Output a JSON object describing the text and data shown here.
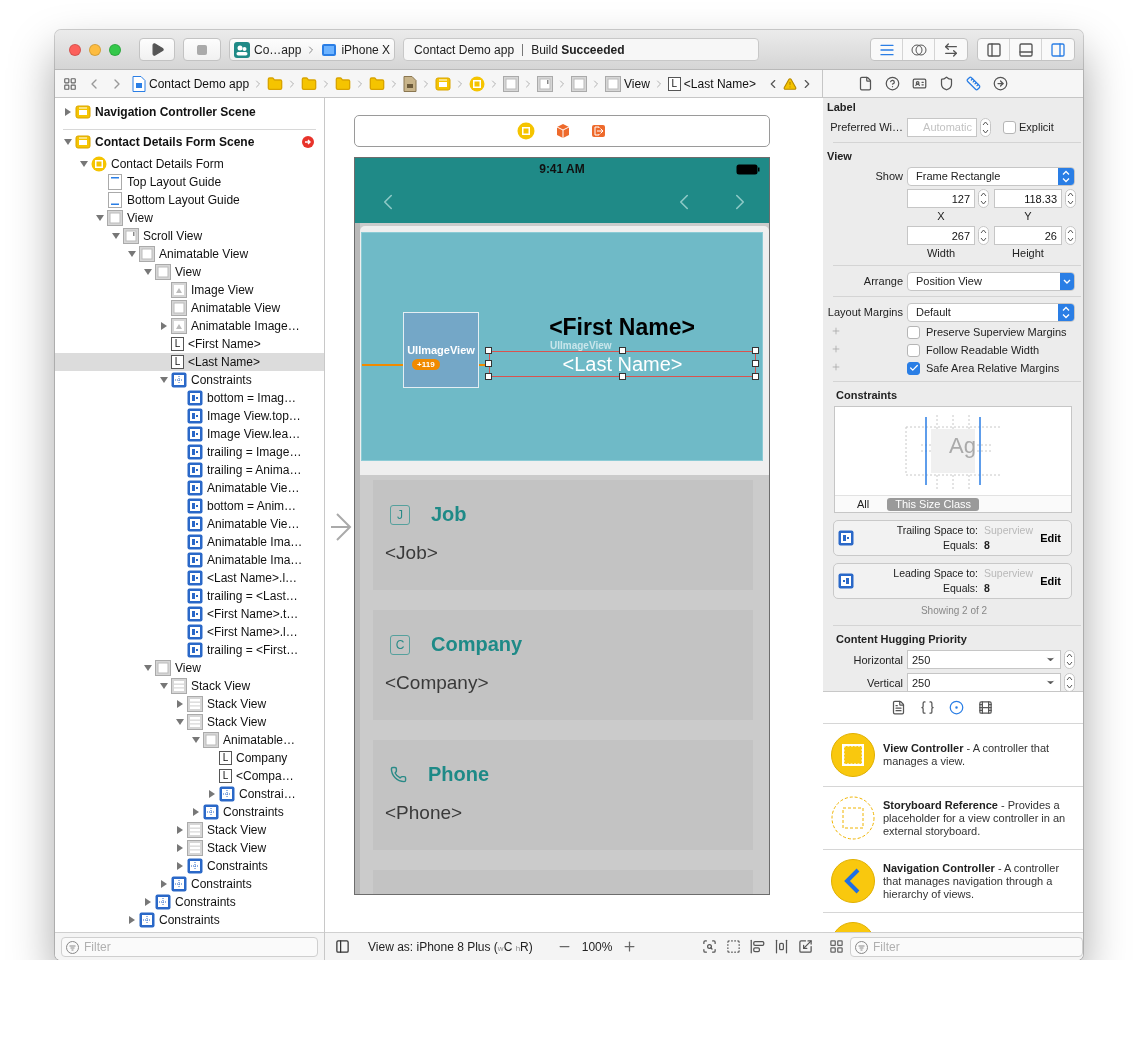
{
  "toolbar": {
    "scheme": "Co…app",
    "device": "iPhone X",
    "activity_project": "Contact Demo app",
    "activity_status": "Build **Succeeded**",
    "editor_modes": [
      {
        "kind": "standard",
        "selected": true
      },
      {
        "kind": "assistant",
        "selected": false
      },
      {
        "kind": "version",
        "selected": false
      }
    ],
    "panels": [
      {
        "kind": "navigator",
        "on": false
      },
      {
        "kind": "debug",
        "on": false
      },
      {
        "kind": "utilities",
        "on": true
      }
    ]
  },
  "jump_bar": {
    "items": [
      {
        "kind": "project",
        "label": "Contact Demo app"
      },
      {
        "kind": "folder"
      },
      {
        "kind": "folder"
      },
      {
        "kind": "folder"
      },
      {
        "kind": "folder"
      },
      {
        "kind": "storyboard"
      },
      {
        "kind": "scene"
      },
      {
        "kind": "controller"
      },
      {
        "kind": "view"
      },
      {
        "kind": "scroll"
      },
      {
        "kind": "view"
      },
      {
        "kind": "view",
        "label": "View"
      },
      {
        "kind": "label",
        "icon_text": "L",
        "label": "<Last Name>"
      }
    ]
  },
  "inspector_tabs": [
    {
      "kind": "file",
      "selected": false
    },
    {
      "kind": "help",
      "selected": false
    },
    {
      "kind": "identity",
      "selected": false
    },
    {
      "kind": "attributes",
      "selected": false
    },
    {
      "kind": "size",
      "selected": true
    },
    {
      "kind": "connections",
      "selected": false
    }
  ],
  "outline": {
    "filter_placeholder": "Filter",
    "items": [
      {
        "label": "Navigation Controller Scene",
        "kind": "scene",
        "expanded": false,
        "selected": false
      },
      {
        "label": "Contact Details Form Scene",
        "kind": "scene",
        "expanded": true,
        "selected": false,
        "error": true,
        "children": [
          {
            "label": "Contact Details Form",
            "kind": "controller",
            "expanded": true,
            "selected": false,
            "children": [
              {
                "label": "Top Layout Guide",
                "kind": "guide-top",
                "selected": false
              },
              {
                "label": "Bottom Layout Guide",
                "kind": "guide-bottom",
                "selected": false
              },
              {
                "label": "View",
                "kind": "view",
                "expanded": true,
                "selected": false,
                "children": [
                  {
                    "label": "Scroll View",
                    "kind": "scroll",
                    "expanded": true,
                    "selected": false,
                    "children": [
                      {
                        "label": "Animatable View",
                        "kind": "view",
                        "expanded": true,
                        "selected": false,
                        "children": [
                          {
                            "label": "View",
                            "kind": "view",
                            "expanded": true,
                            "selected": false,
                            "children": [
                              {
                                "label": "Image View",
                                "kind": "image",
                                "selected": false
                              },
                              {
                                "label": "Animatable View",
                                "kind": "view",
                                "selected": false
                              },
                              {
                                "label": "Animatable Image…",
                                "kind": "image",
                                "expanded": false,
                                "selected": false
                              },
                              {
                                "label": "<First Name>",
                                "kind": "label",
                                "icon_text": "L",
                                "selected": false
                              },
                              {
                                "label": "<Last Name>",
                                "kind": "label",
                                "icon_text": "L",
                                "selected": true
                              },
                              {
                                "label": "Constraints",
                                "kind": "constraints",
                                "expanded": true,
                                "selected": false,
                                "children": [
                                  {
                                    "label": "bottom = Imag…",
                                    "kind": "constraint",
                                    "selected": false
                                  },
                                  {
                                    "label": "Image View.top…",
                                    "kind": "constraint",
                                    "selected": false
                                  },
                                  {
                                    "label": "Image View.lea…",
                                    "kind": "constraint",
                                    "selected": false
                                  },
                                  {
                                    "label": "trailing = Image…",
                                    "kind": "constraint",
                                    "selected": false
                                  },
                                  {
                                    "label": "trailing = Anima…",
                                    "kind": "constraint",
                                    "selected": false
                                  },
                                  {
                                    "label": "Animatable Vie…",
                                    "kind": "constraint",
                                    "selected": false
                                  },
                                  {
                                    "label": "bottom = Anim…",
                                    "kind": "constraint",
                                    "selected": false
                                  },
                                  {
                                    "label": "Animatable Vie…",
                                    "kind": "constraint",
                                    "selected": false
                                  },
                                  {
                                    "label": "Animatable Ima…",
                                    "kind": "constraint",
                                    "selected": false
                                  },
                                  {
                                    "label": "Animatable Ima…",
                                    "kind": "constraint",
                                    "selected": false
                                  },
                                  {
                                    "label": "<Last Name>.l…",
                                    "kind": "constraint",
                                    "selected": false
                                  },
                                  {
                                    "label": "trailing = <Last…",
                                    "kind": "constraint",
                                    "selected": false
                                  },
                                  {
                                    "label": "<First Name>.t…",
                                    "kind": "constraint",
                                    "selected": false
                                  },
                                  {
                                    "label": "<First Name>.l…",
                                    "kind": "constraint",
                                    "selected": false
                                  },
                                  {
                                    "label": "trailing = <First…",
                                    "kind": "constraint",
                                    "selected": false
                                  }
                                ]
                              }
                            ]
                          },
                          {
                            "label": "View",
                            "kind": "view",
                            "expanded": true,
                            "selected": false,
                            "children": [
                              {
                                "label": "Stack View",
                                "kind": "stack",
                                "expanded": true,
                                "selected": false,
                                "children": [
                                  {
                                    "label": "Stack View",
                                    "kind": "stack",
                                    "expanded": false,
                                    "selected": false
                                  },
                                  {
                                    "label": "Stack View",
                                    "kind": "stack",
                                    "expanded": true,
                                    "selected": false,
                                    "children": [
                                      {
                                        "label": "Animatable…",
                                        "kind": "view",
                                        "expanded": true,
                                        "selected": false,
                                        "children": [
                                          {
                                            "label": "Company",
                                            "kind": "label",
                                            "icon_text": "L",
                                            "selected": false
                                          },
                                          {
                                            "label": "<Compa…",
                                            "kind": "label",
                                            "icon_text": "L",
                                            "selected": false
                                          },
                                          {
                                            "label": "Constrai…",
                                            "kind": "constraints",
                                            "expanded": false,
                                            "selected": false
                                          }
                                        ]
                                      },
                                      {
                                        "label": "Constraints",
                                        "kind": "constraints",
                                        "expanded": false,
                                        "selected": false
                                      }
                                    ]
                                  },
                                  {
                                    "label": "Stack View",
                                    "kind": "stack",
                                    "expanded": false,
                                    "selected": false
                                  },
                                  {
                                    "label": "Stack View",
                                    "kind": "stack",
                                    "expanded": false,
                                    "selected": false
                                  },
                                  {
                                    "label": "Constraints",
                                    "kind": "constraints",
                                    "expanded": false,
                                    "selected": false
                                  }
                                ]
                              },
                              {
                                "label": "Constraints",
                                "kind": "constraints",
                                "expanded": false,
                                "selected": false
                              }
                            ]
                          },
                          {
                            "label": "Constraints",
                            "kind": "constraints",
                            "expanded": false,
                            "selected": false
                          }
                        ]
                      },
                      {
                        "label": "Constraints",
                        "kind": "constraints",
                        "expanded": false,
                        "selected": false
                      }
                    ]
                  }
                ]
              }
            ]
          }
        ]
      }
    ]
  },
  "canvas": {
    "scene_dock": [
      {
        "kind": "controller"
      },
      {
        "kind": "first-responder"
      },
      {
        "kind": "exit"
      }
    ],
    "status_time": "9:41 AM",
    "image_placeholder": "UIImageView",
    "ghost_label": "UIImageView",
    "constraint_badge": "+119",
    "first_name": "<First Name>",
    "last_name": "<Last Name>",
    "cards": [
      {
        "kind": "letter",
        "icon_text": "J",
        "title": "Job",
        "value": "<Job>"
      },
      {
        "kind": "letter",
        "icon_text": "C",
        "title": "Company",
        "value": "<Company>"
      },
      {
        "kind": "phone",
        "title": "Phone",
        "value": "<Phone>"
      },
      {
        "kind": "cut"
      }
    ],
    "view_as": "View as: iPhone 8 Plus ($_{w}$C $_{h}$R)",
    "zoom": "100%"
  },
  "inspector": {
    "label_section": {
      "title": "Label",
      "preferred_width_label": "Preferred Wi…",
      "preferred_width_placeholder": "Automatic",
      "explicit": {
        "label": "Explicit",
        "checked": false
      }
    },
    "view_section": {
      "title": "View",
      "show_label": "Show",
      "show_value": "Frame Rectangle",
      "frame": [
        {
          "value": "127",
          "label": "X"
        },
        {
          "value": "118.33",
          "label": "Y"
        },
        {
          "value": "267",
          "label": "Width"
        },
        {
          "value": "26",
          "label": "Height"
        }
      ],
      "arrange_label": "Arrange",
      "arrange_value": "Position View",
      "margins_label": "Layout Margins",
      "margins_value": "Default",
      "options": [
        {
          "label": "Preserve Superview Margins",
          "checked": false
        },
        {
          "label": "Follow Readable Width",
          "checked": false
        },
        {
          "label": "Safe Area Relative Margins",
          "checked": true
        }
      ]
    },
    "constraints": {
      "title": "Constraints",
      "diagram_text": "Ag",
      "filters": [
        {
          "label": "All",
          "selected": false
        },
        {
          "label": "This Size Class",
          "selected": true
        }
      ],
      "items": [
        {
          "kind": "trailing",
          "title": "Trailing Space to:",
          "target": "Superview",
          "equals_label": "Equals:",
          "value": "8",
          "action": "Edit"
        },
        {
          "kind": "leading",
          "title": "Leading Space to:",
          "target": "Superview",
          "equals_label": "Equals:",
          "value": "8",
          "action": "Edit"
        }
      ],
      "summary": "Showing 2 of 2"
    },
    "hugging": {
      "title": "Content Hugging Priority",
      "rows": [
        {
          "label": "Horizontal",
          "value": "250"
        },
        {
          "label": "Vertical",
          "value": "250"
        }
      ]
    }
  },
  "library": {
    "tabs": [
      {
        "kind": "file",
        "selected": false
      },
      {
        "kind": "code",
        "selected": false
      },
      {
        "kind": "object",
        "selected": true
      },
      {
        "kind": "media",
        "selected": false
      }
    ],
    "items": [
      {
        "kind": "view-controller",
        "text": "**View Controller** - A controller that manages a view."
      },
      {
        "kind": "storyboard-reference",
        "text": "**Storyboard Reference** - Provides a placeholder for a view controller in an external storyboard."
      },
      {
        "kind": "navigation-controller",
        "text": "**Navigation Controller** - A controller that manages navigation through a hierarchy of views."
      },
      {
        "kind": "partial"
      }
    ],
    "filter_placeholder": "Filter"
  }
}
